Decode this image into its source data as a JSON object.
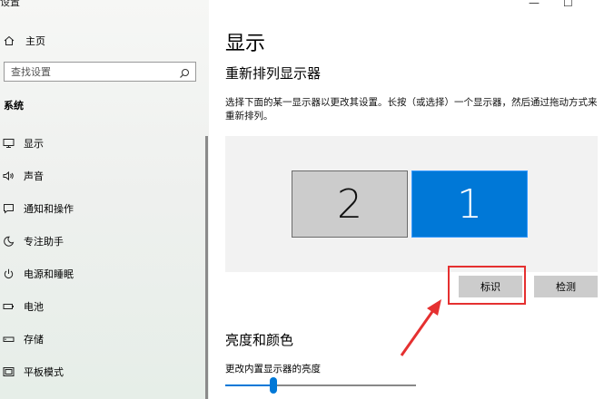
{
  "window": {
    "title": "设置",
    "minimize_glyph": "—",
    "maximize_glyph": "☐"
  },
  "sidebar": {
    "home_label": "主页",
    "search_placeholder": "查找设置",
    "section_title": "系统",
    "items": [
      {
        "label": "显示",
        "icon": "monitor-icon"
      },
      {
        "label": "声音",
        "icon": "speaker-icon"
      },
      {
        "label": "通知和操作",
        "icon": "notification-icon"
      },
      {
        "label": "专注助手",
        "icon": "moon-icon"
      },
      {
        "label": "电源和睡眠",
        "icon": "power-icon"
      },
      {
        "label": "电池",
        "icon": "battery-icon"
      },
      {
        "label": "存储",
        "icon": "storage-icon"
      },
      {
        "label": "平板模式",
        "icon": "tablet-icon"
      }
    ]
  },
  "main": {
    "title": "显示",
    "arrange_heading": "重新排列显示器",
    "arrange_desc": "选择下面的某一显示器以更改其设置。长按（或选择）一个显示器，然后通过拖动方式来重新排列。",
    "monitors": [
      {
        "number": "2",
        "selected": false
      },
      {
        "number": "1",
        "selected": true
      }
    ],
    "identify_label": "标识",
    "detect_label": "检测",
    "brightness_heading": "亮度和颜色",
    "brightness_label": "更改内置显示器的亮度",
    "brightness_value": 0.25
  },
  "colors": {
    "accent": "#0078d7",
    "highlight": "#e53030"
  }
}
